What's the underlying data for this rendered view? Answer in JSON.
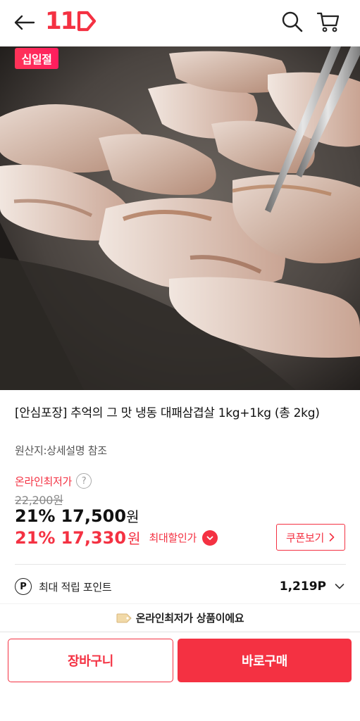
{
  "header": {
    "logo_text": "11",
    "back_icon": "arrow-left-icon",
    "search_icon": "search-icon",
    "cart_icon": "cart-icon",
    "accent": "#f43142"
  },
  "image": {
    "promo_badge": "십일절"
  },
  "product": {
    "title": "[안심포장] 추억의 그 맛 냉동 대패삼겹살 1kg+1kg (총 2kg)",
    "origin": "원산지:상세설명 참조",
    "lowest_label": "온라인최저가",
    "original_price": "22,200원",
    "discount_rate": "21%",
    "price": "17,500",
    "price_unit": "원",
    "max_discount_rate": "21%",
    "max_price": "17,330",
    "max_price_unit": "원",
    "max_discount_label": "최대할인가",
    "coupon_button": "쿠폰보기"
  },
  "points": {
    "icon_letter": "P",
    "label": "최대 적립 포인트",
    "value": "1,219P"
  },
  "notice": {
    "text": "온라인최저가 상품이에요"
  },
  "actions": {
    "cart_label": "장바구니",
    "buy_label": "바로구매"
  }
}
